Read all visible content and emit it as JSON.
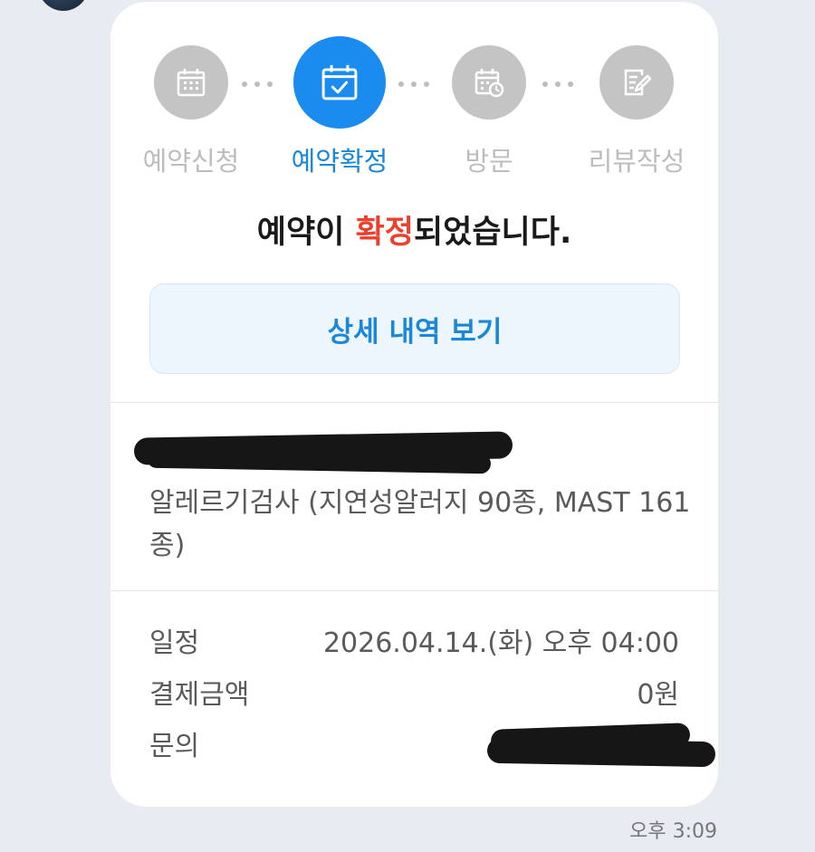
{
  "steps": [
    {
      "label": "예약신청",
      "icon": "calendar-grid-icon",
      "active": false
    },
    {
      "label": "예약확정",
      "icon": "calendar-check-icon",
      "active": true
    },
    {
      "label": "방문",
      "icon": "calendar-clock-icon",
      "active": false
    },
    {
      "label": "리뷰작성",
      "icon": "document-pen-icon",
      "active": false
    }
  ],
  "headline": {
    "before": "예약이 ",
    "accent": "확정",
    "after": "되었습니다."
  },
  "detail_button_label": "상세 내역 보기",
  "service": {
    "name": "알레르기검사 (지연성알러지 90종, MAST 161종)"
  },
  "info": {
    "schedule_label": "일정",
    "schedule_value": "2026.04.14.(화) 오후 04:00",
    "payment_label": "결제금액",
    "payment_value": "0원",
    "inquiry_label": "문의"
  },
  "timestamp": "오후 3:09",
  "colors": {
    "accent_blue": "#1a8cf0",
    "accent_red": "#ee3e2c",
    "inactive_gray": "#c4c4c4",
    "background": "#e8ebf2"
  }
}
